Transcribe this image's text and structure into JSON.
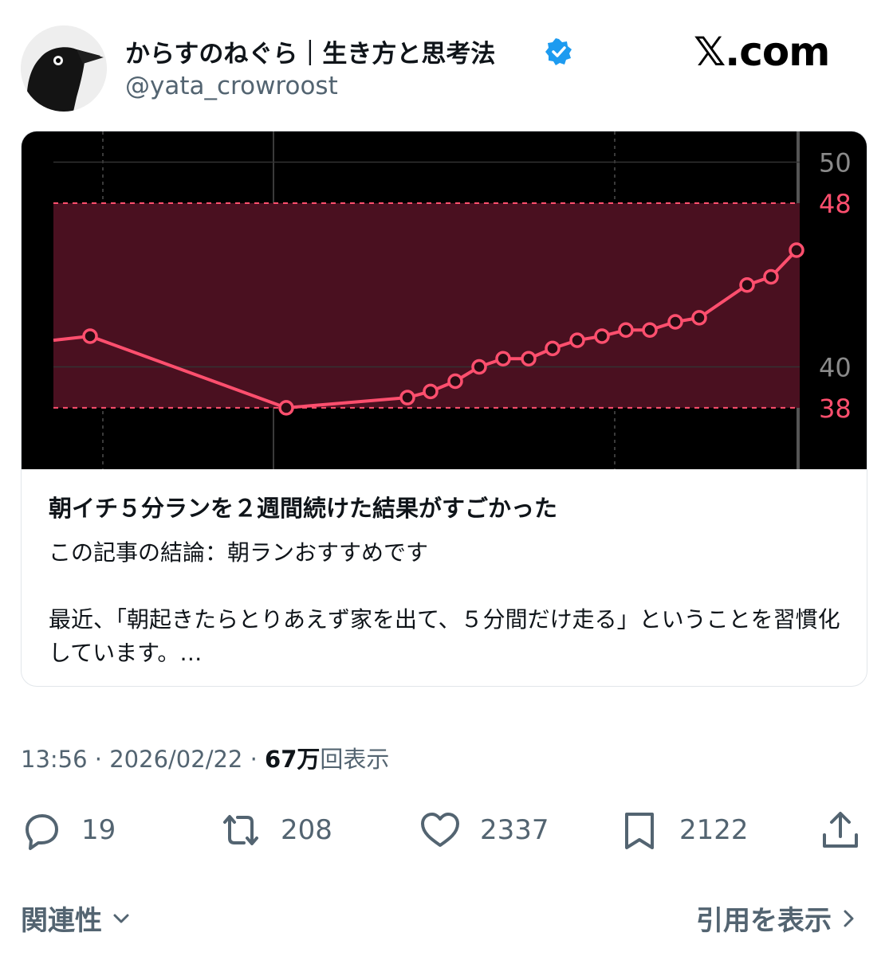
{
  "author": {
    "display_name": "からすのねぐら｜生き方と思考法",
    "handle": "@yata_crowroost",
    "verified": true,
    "avatar_icon": "crow-avatar-icon"
  },
  "site_logo": "𝕏.com",
  "card": {
    "title": "朝イチ５分ランを２週間続けた結果がすごかった",
    "description": "この記事の結論：朝ランおすすめです\n\n最近、「朝起きたらとりあえず家を出て、５分間だけ走る」ということを習慣化しています。…"
  },
  "chart_data": {
    "type": "line",
    "title": "",
    "xlabel": "",
    "ylabel": "",
    "ylim": [
      35,
      51.5
    ],
    "yticks": [
      {
        "value": 50,
        "label": "50",
        "highlight": false
      },
      {
        "value": 48,
        "label": "48",
        "highlight": true
      },
      {
        "value": 40,
        "label": "40",
        "highlight": false
      },
      {
        "value": 38,
        "label": "38",
        "highlight": true
      }
    ],
    "band": {
      "low": 38,
      "high": 48
    },
    "grid": true,
    "series": [
      {
        "values": [
          41.3,
          41.5,
          38.0,
          38.5,
          38.8,
          39.3,
          40.0,
          40.4,
          40.4,
          40.9,
          41.3,
          41.5,
          41.8,
          41.8,
          42.2,
          42.4,
          44.0,
          44.4,
          45.7
        ],
        "color": "#ff4f6e"
      }
    ],
    "colors": {
      "line": "#ff4f6e",
      "band": "#4a1020",
      "dashed": "#ff4f6e",
      "axis_text": "#8a8a8a"
    }
  },
  "meta": {
    "time": "13:56",
    "separator": "·",
    "date": "2026/02/22",
    "views_number": "67万",
    "views_label": "回表示"
  },
  "actions": {
    "replies": "19",
    "reposts": "208",
    "likes": "2337",
    "bookmarks": "2122"
  },
  "footer": {
    "sort_label": "関連性",
    "quotes_link": "引用を表示"
  }
}
